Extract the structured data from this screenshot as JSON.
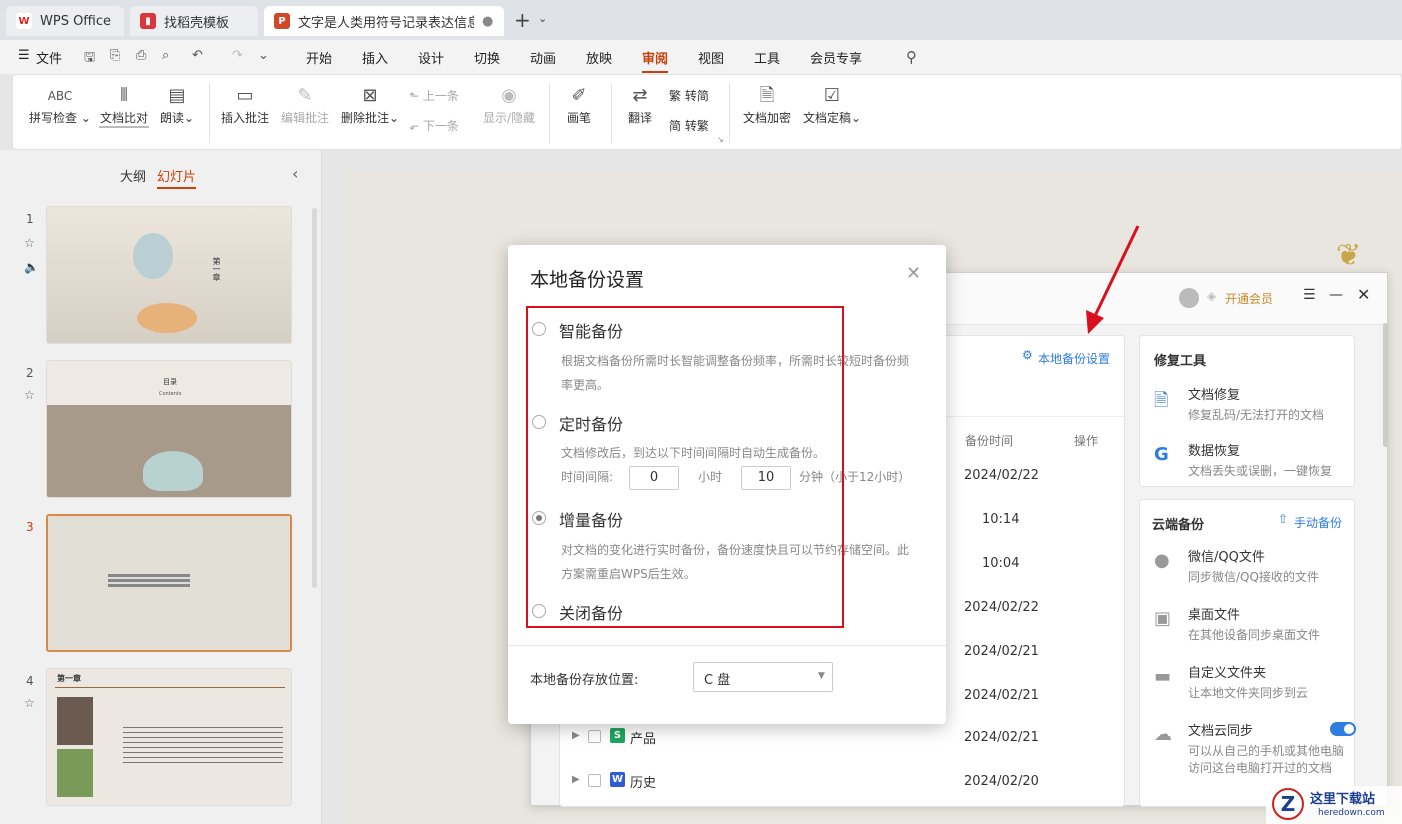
{
  "tabs": [
    {
      "label": "WPS Office"
    },
    {
      "label": "找稻壳模板"
    },
    {
      "label": "文字是人类用符号记录表达信息以"
    }
  ],
  "menu": {
    "file": "文件",
    "items": [
      "开始",
      "插入",
      "设计",
      "切换",
      "动画",
      "放映",
      "审阅",
      "视图",
      "工具",
      "会员专享"
    ],
    "active": "审阅"
  },
  "ribbon": {
    "spell": "拼写检查",
    "compare": "文档比对",
    "read": "朗读",
    "insert_comment": "插入批注",
    "edit_comment": "编辑批注",
    "delete_comment": "删除批注",
    "prev": "上一条",
    "next": "下一条",
    "show_hide": "显示/隐藏",
    "pen": "画笔",
    "translate": "翻译",
    "to_trad": "繁 转简",
    "to_simp": "简 转繁",
    "encrypt": "文档加密",
    "finalize": "文档定稿",
    "abc": "ABC"
  },
  "left_panel": {
    "outline": "大纲",
    "slides": "幻灯片",
    "slide_numbers": [
      "1",
      "2",
      "3",
      "4"
    ],
    "slide1_title": "第一章",
    "slide2_title": "目录",
    "slide2_sub": "Contents",
    "slide4_title": "第一章"
  },
  "backup_window": {
    "open_member": "开通会员",
    "local_setting_link": "本地备份设置",
    "col_time": "备份时间",
    "col_op": "操作",
    "times": [
      "2024/02/22",
      "10:14",
      "10:04",
      "2024/02/22",
      "2024/02/21",
      "2024/02/21",
      "2024/02/21",
      "2024/02/20"
    ],
    "files": [
      {
        "icon": "S",
        "name": "产品"
      },
      {
        "icon": "W",
        "name": "历史"
      }
    ],
    "repair_title": "修复工具",
    "repair": [
      {
        "t": "文档修复",
        "s": "修复乱码/无法打开的文档"
      },
      {
        "t": "数据恢复",
        "s": "文档丢失或误删，一键恢复"
      }
    ],
    "cloud_title": "云端备份",
    "manual_backup": "手动备份",
    "cloud": [
      {
        "t": "微信/QQ文件",
        "s": "同步微信/QQ接收的文件"
      },
      {
        "t": "桌面文件",
        "s": "在其他设备同步桌面文件"
      },
      {
        "t": "自定义文件夹",
        "s": "让本地文件夹同步到云"
      },
      {
        "t": "文档云同步",
        "s": "可以从自己的手机或其他电脑访问这台电脑打开过的文档"
      }
    ]
  },
  "dialog": {
    "title": "本地备份设置",
    "smart": "智能备份",
    "smart_desc": "根据文档备份所需时长智能调整备份频率，所需时长较短时备份频率更高。",
    "timed": "定时备份",
    "timed_desc": "文档修改后，到达以下时间间隔时自动生成备份。",
    "interval_label": "时间间隔:",
    "hours": "0",
    "hours_unit": "小时",
    "minutes": "10",
    "minutes_unit": "分钟（小于12小时）",
    "incremental": "增量备份",
    "inc_desc": "对文档的变化进行实时备份，备份速度快且可以节约存储空间。此方案需重启WPS后生效。",
    "off": "关闭备份",
    "selected": "增量备份",
    "location_label": "本地备份存放位置:",
    "location_value": "C 盘"
  },
  "watermark": {
    "text": "这里下载站",
    "url": "heredown.com"
  },
  "colors": {
    "accent": "#c7420a",
    "red": "#d9101c",
    "blue": "#2f7de1"
  }
}
